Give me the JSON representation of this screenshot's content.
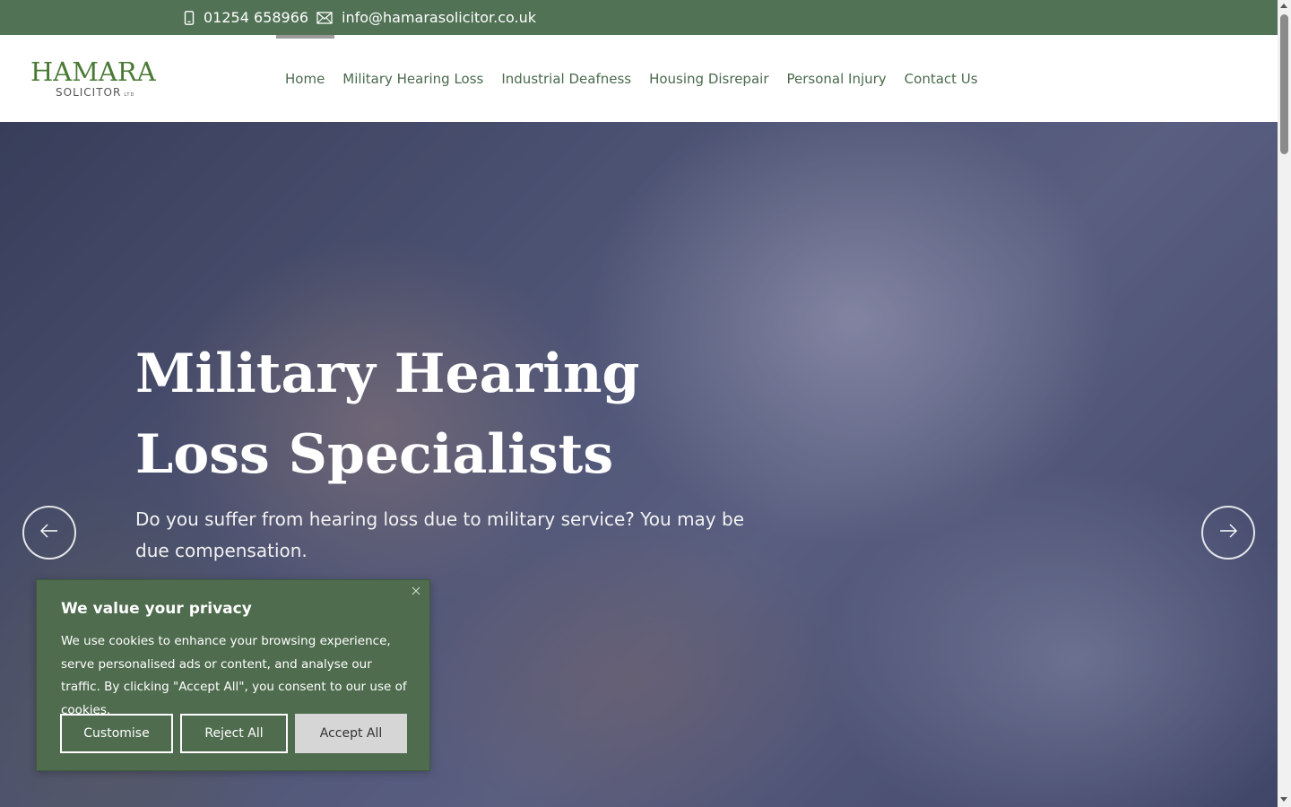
{
  "topbar": {
    "phone": "01254 658966",
    "email": "info@hamarasolicitor.co.uk",
    "phone_icon": "mobile-phone-icon",
    "email_icon": "envelope-icon",
    "bg_color": "#517255"
  },
  "header": {
    "logo": {
      "brand": "HAMARA",
      "sub": "SOLICITOR",
      "ltd": "LTD"
    },
    "nav": [
      {
        "label": "Home",
        "active": true
      },
      {
        "label": "Military Hearing Loss"
      },
      {
        "label": "Industrial Deafness"
      },
      {
        "label": "Housing Disrepair"
      },
      {
        "label": "Personal Injury"
      },
      {
        "label": "Contact Us"
      }
    ]
  },
  "hero": {
    "title": "Military Hearing Loss Specialists",
    "lead": "Do you suffer from hearing loss due to military service? You may be due compensation.",
    "prev_icon": "arrow-left-icon",
    "next_icon": "arrow-right-icon"
  },
  "cookie": {
    "title": "We value your privacy",
    "text": "We use cookies to enhance your browsing experience, serve personalised ads or content, and analyse our traffic. By clicking \"Accept All\", you consent to our use of cookies.",
    "buttons": {
      "customise": "Customise",
      "reject": "Reject All",
      "accept": "Accept All"
    },
    "bg_color": "#4f6c4f"
  }
}
